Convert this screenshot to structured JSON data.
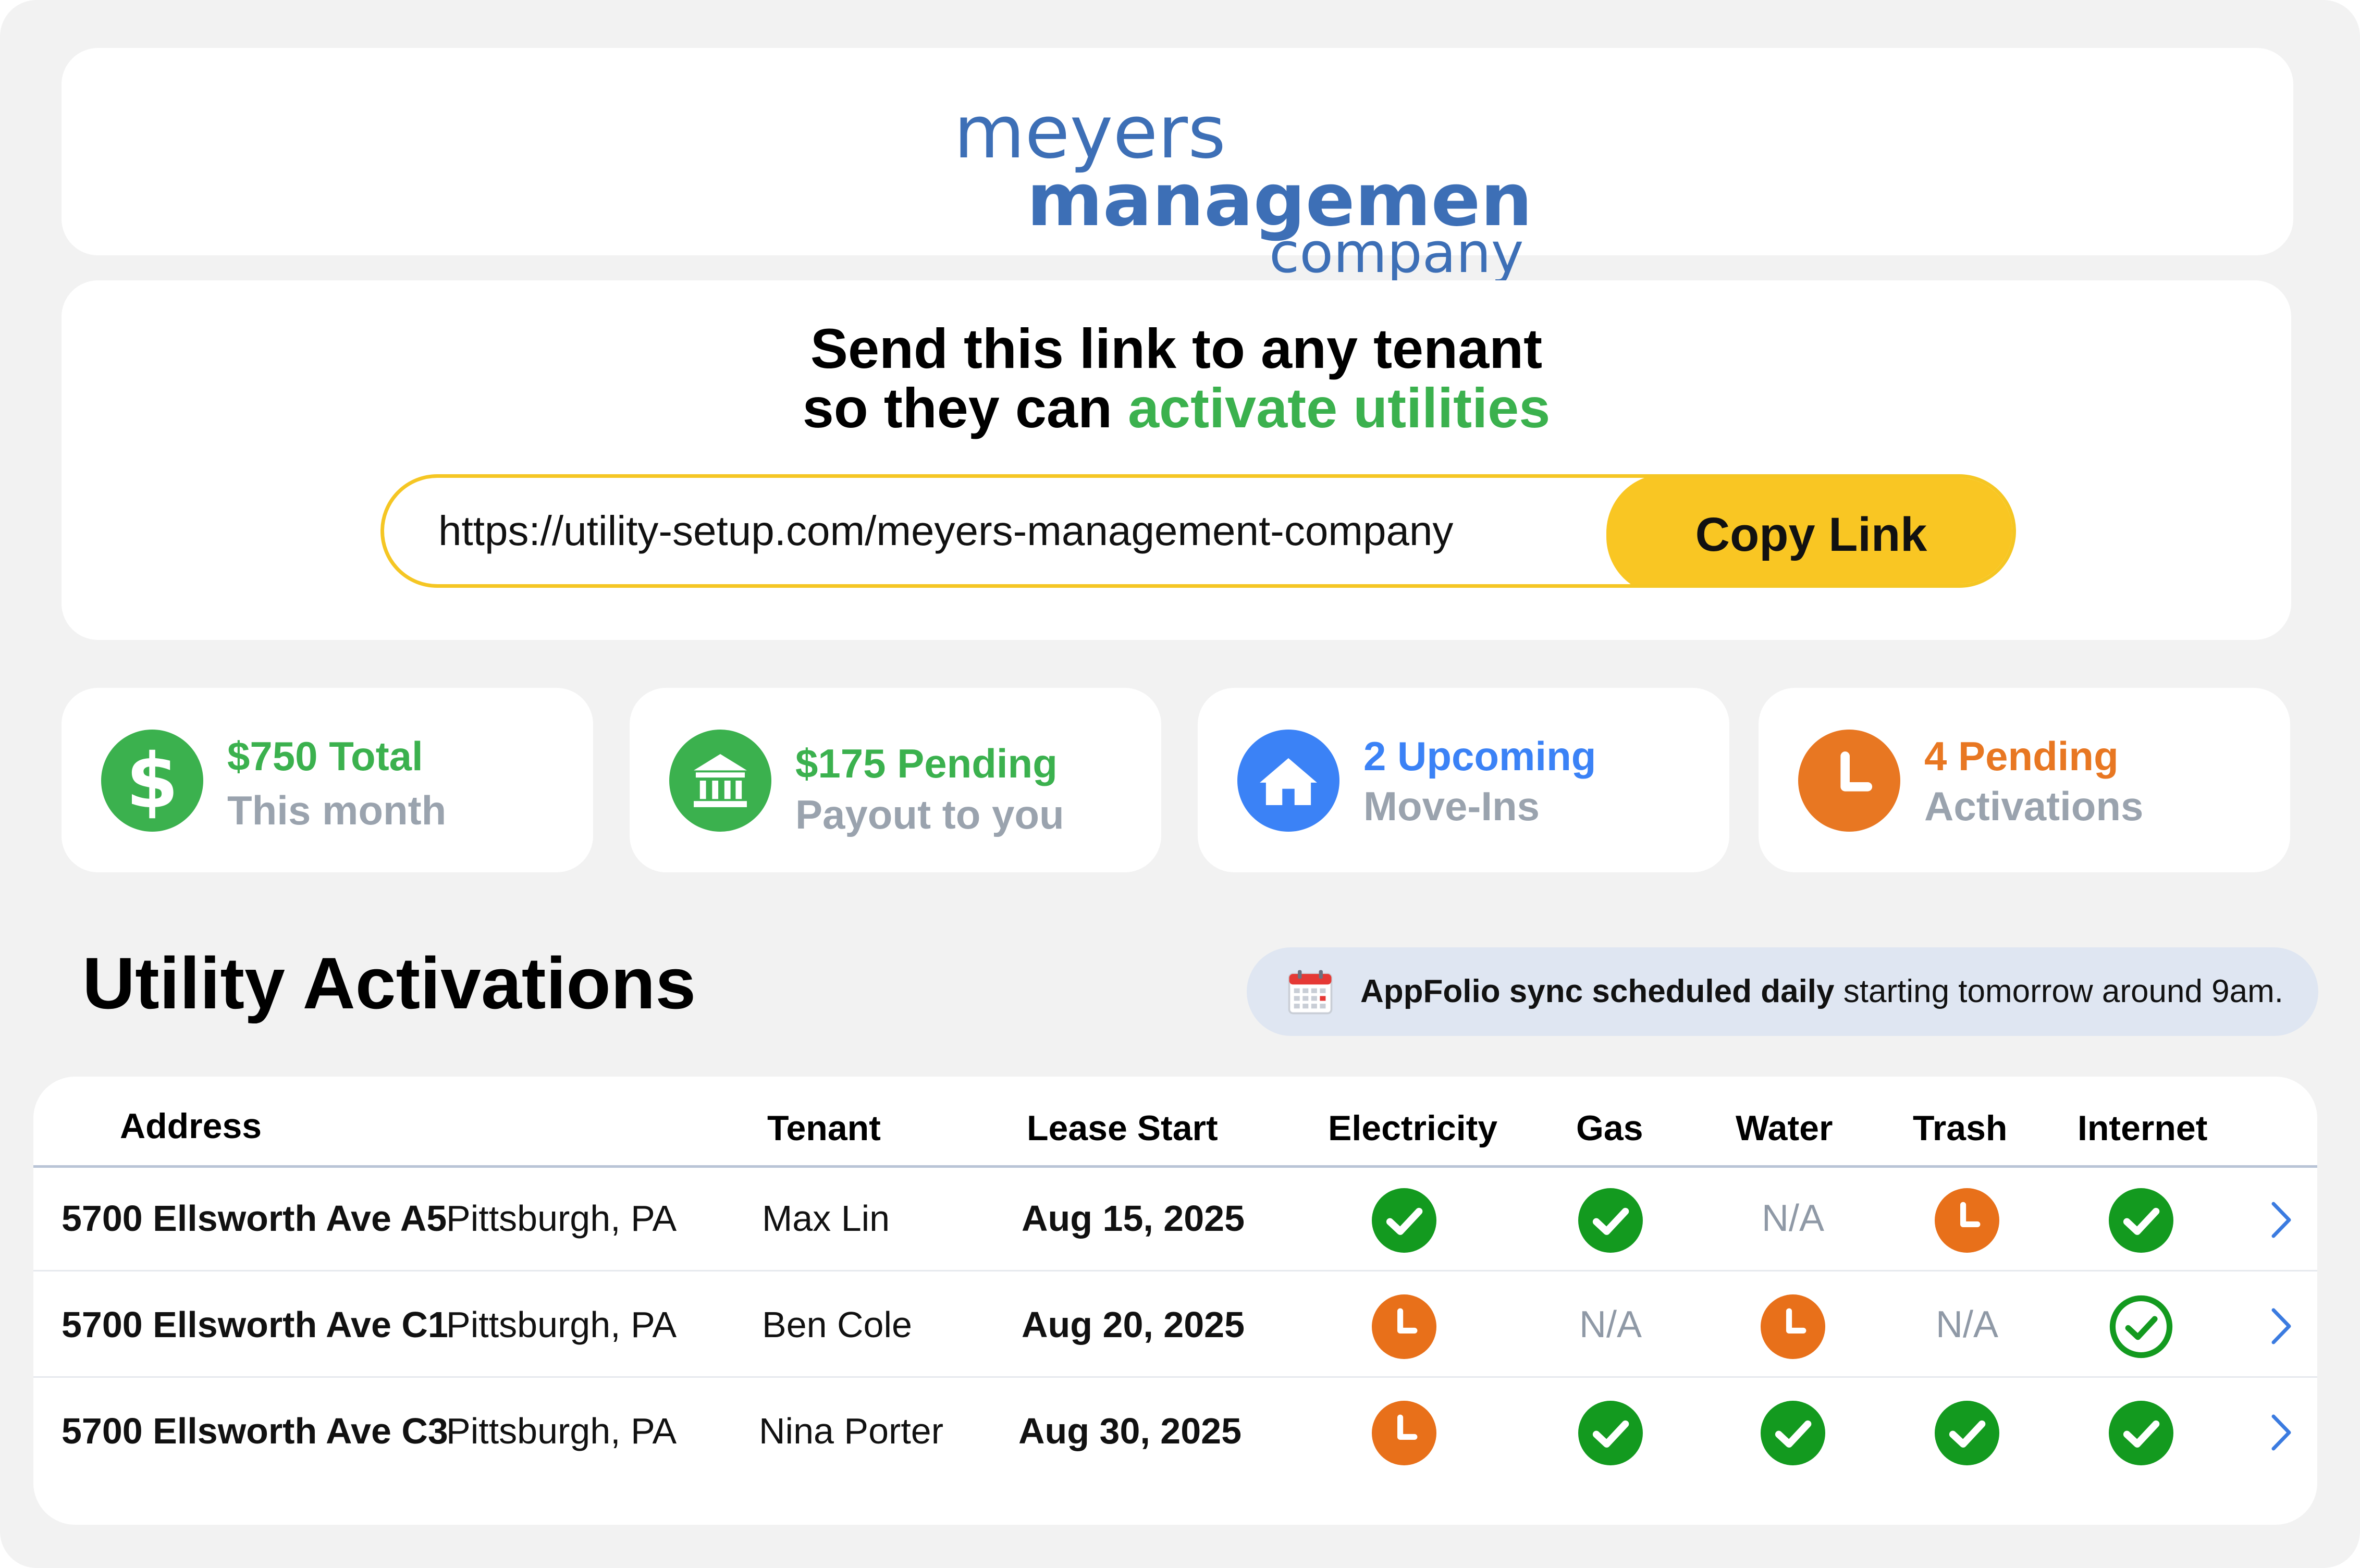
{
  "logo": {
    "line1": "meyers",
    "line2": "management",
    "line3": "company",
    "color": "#3d6fb6"
  },
  "link_card": {
    "heading_line1": "Send this link to any tenant",
    "heading_line2_prefix": "so they can ",
    "heading_line2_accent": "activate utilities",
    "url": "https://utility-setup.com/meyers-management-company",
    "copy_label": "Copy Link"
  },
  "stats": [
    {
      "line1": "$750 Total",
      "line2": "This month",
      "color": "#3bb14e",
      "icon": "dollar-icon"
    },
    {
      "line1": "$175 Pending",
      "line2": "Payout to you",
      "color": "#3bb14e",
      "icon": "bank-icon"
    },
    {
      "line1": "2 Upcoming",
      "line2": "Move-Ins",
      "color": "#3b82f6",
      "icon": "home-icon"
    },
    {
      "line1": "4 Pending",
      "line2": "Activations",
      "color": "#e87722",
      "icon": "clock-icon"
    }
  ],
  "section_title": "Utility Activations",
  "sync_banner": {
    "bold": "AppFolio sync scheduled daily",
    "rest": " starting tomorrow around 9am."
  },
  "table": {
    "headers": [
      "Address",
      "Tenant",
      "Lease Start",
      "Electricity",
      "Gas",
      "Water",
      "Trash",
      "Internet"
    ],
    "rows": [
      {
        "address": "5700 Ellsworth Ave A5",
        "city": "Pittsburgh, PA",
        "tenant": "Max Lin",
        "lease_start": "Aug 15, 2025",
        "electricity": "active",
        "gas": "active",
        "water": "N/A",
        "trash": "pending",
        "internet": "active"
      },
      {
        "address": "5700 Ellsworth Ave C1",
        "city": "Pittsburgh, PA",
        "tenant": "Ben Cole",
        "lease_start": "Aug 20, 2025",
        "electricity": "pending",
        "gas": "N/A",
        "water": "pending",
        "trash": "N/A",
        "internet": "confirmed"
      },
      {
        "address": "5700 Ellsworth Ave C3",
        "city": "Pittsburgh, PA",
        "tenant": "Nina Porter",
        "lease_start": "Aug 30, 2025",
        "electricity": "pending",
        "gas": "active",
        "water": "active",
        "trash": "active",
        "internet": "active"
      }
    ]
  },
  "colors": {
    "green": "#139a1f",
    "orange": "#e8701a",
    "blue_chevron": "#3b7be0"
  }
}
